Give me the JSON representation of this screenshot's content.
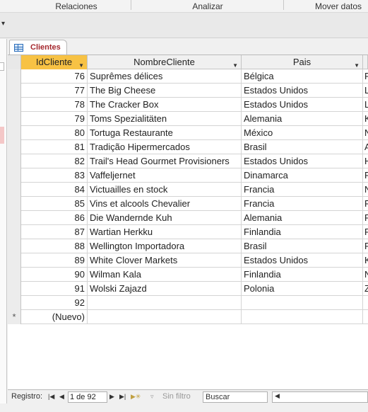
{
  "ribbon": {
    "groups": [
      "Relaciones",
      "Analizar",
      "Mover datos"
    ]
  },
  "tab": {
    "label": "Clientes"
  },
  "columns": [
    "IdCliente",
    "NombreCliente",
    "Pais",
    ""
  ],
  "rows": [
    {
      "id": "76",
      "name": "Suprêmes délices",
      "country": "Bélgica",
      "extra": "F"
    },
    {
      "id": "77",
      "name": "The Big Cheese",
      "country": "Estados Unidos",
      "extra": "L"
    },
    {
      "id": "78",
      "name": "The Cracker Box",
      "country": "Estados Unidos",
      "extra": "L"
    },
    {
      "id": "79",
      "name": "Toms Spezialitäten",
      "country": "Alemania",
      "extra": "K"
    },
    {
      "id": "80",
      "name": "Tortuga Restaurante",
      "country": "México",
      "extra": "N"
    },
    {
      "id": "81",
      "name": "Tradição Hipermercados",
      "country": "Brasil",
      "extra": "A"
    },
    {
      "id": "82",
      "name": "Trail's Head Gourmet Provisioners",
      "country": "Estados Unidos",
      "extra": "H"
    },
    {
      "id": "83",
      "name": "Vaffeljernet",
      "country": "Dinamarca",
      "extra": "F"
    },
    {
      "id": "84",
      "name": "Victuailles en stock",
      "country": "Francia",
      "extra": "N"
    },
    {
      "id": "85",
      "name": "Vins et alcools Chevalier",
      "country": "Francia",
      "extra": "F"
    },
    {
      "id": "86",
      "name": "Die Wandernde Kuh",
      "country": "Alemania",
      "extra": "F"
    },
    {
      "id": "87",
      "name": "Wartian Herkku",
      "country": "Finlandia",
      "extra": "F"
    },
    {
      "id": "88",
      "name": "Wellington Importadora",
      "country": "Brasil",
      "extra": "F"
    },
    {
      "id": "89",
      "name": "White Clover Markets",
      "country": "Estados Unidos",
      "extra": "K"
    },
    {
      "id": "90",
      "name": "Wilman Kala",
      "country": "Finlandia",
      "extra": "N"
    },
    {
      "id": "91",
      "name": "Wolski  Zajazd",
      "country": "Polonia",
      "extra": "Z"
    },
    {
      "id": "92",
      "name": "",
      "country": "",
      "extra": ""
    }
  ],
  "new_row": {
    "marker": "*",
    "id": "(Nuevo)"
  },
  "navigation": {
    "label": "Registro:",
    "position": "1 de 92",
    "filter": "Sin filtro",
    "search": "Buscar"
  },
  "icons": {
    "first": "first-record-icon",
    "prev": "prev-record-icon",
    "next": "next-record-icon",
    "last": "last-record-icon",
    "new": "new-record-icon",
    "filter": "filter-icon"
  },
  "colors": {
    "active_header": "#f7c244",
    "tab_text": "#a4262c"
  }
}
